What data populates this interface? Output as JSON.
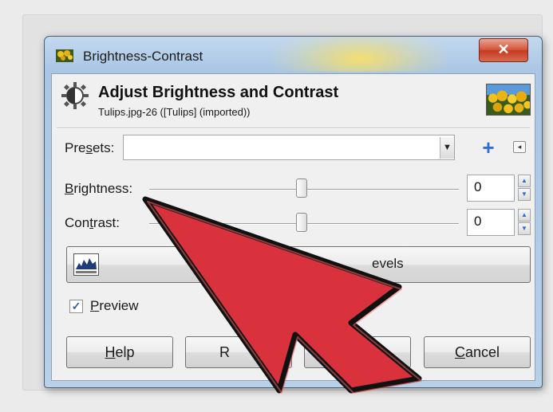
{
  "window": {
    "title": "Brightness-Contrast",
    "close_glyph": "✕"
  },
  "header": {
    "title": "Adjust Brightness and Contrast",
    "subtitle": "Tulips.jpg-26 ([Tulips] (imported))"
  },
  "presets": {
    "label_pre": "Pre",
    "label_key": "s",
    "label_post": "ets:",
    "value": "",
    "add_icon": "plus-icon",
    "menu_icon": "menu-icon"
  },
  "brightness": {
    "label_key": "B",
    "label_rest": "rightness:",
    "value": "0"
  },
  "contrast": {
    "label_pre": "Con",
    "label_key": "t",
    "label_post": "rast:",
    "value": "0"
  },
  "levels_button": {
    "label": "evels"
  },
  "preview": {
    "checked": true,
    "label_key": "P",
    "label_rest": "review"
  },
  "buttons": {
    "help_key": "H",
    "help_rest": "elp",
    "reset_partial": "R",
    "cancel_key": "C",
    "cancel_rest": "ancel"
  },
  "colors": {
    "accent": "#2f6fd1",
    "arrow_fill": "#d9323c",
    "arrow_stroke": "#111111"
  }
}
